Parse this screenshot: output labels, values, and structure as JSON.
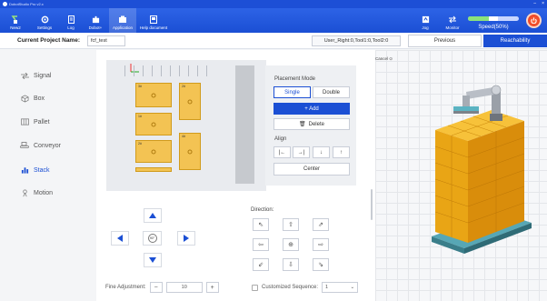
{
  "titlebar": {
    "app_name": "DobotStudio Pro v2.x",
    "min": "–",
    "close": "×"
  },
  "toolbar": {
    "items": [
      {
        "label": "New2",
        "icon": "robot-icon"
      },
      {
        "label": "Settings",
        "icon": "gear-icon"
      },
      {
        "label": "Log",
        "icon": "log-icon"
      },
      {
        "label": "Dobot+",
        "icon": "puzzle-icon"
      },
      {
        "label": "Application",
        "icon": "app-icon"
      },
      {
        "label": "Help document",
        "icon": "doc-icon"
      }
    ],
    "jog_label": "Jog",
    "monitor_label": "Monitor",
    "speed_label": "Speed(50%)",
    "speed_value": 50
  },
  "project": {
    "label": "Current Project Name:",
    "name": "fcf_test",
    "tool_info": "User_Right:0,Tool1:0,Tool2:0",
    "previous_label": "Previous",
    "reachability_label": "Reachability"
  },
  "sidebar": {
    "items": [
      {
        "label": "Signal",
        "icon": "signal-icon"
      },
      {
        "label": "Box",
        "icon": "box-icon"
      },
      {
        "label": "Pallet",
        "icon": "pallet-icon"
      },
      {
        "label": "Conveyor",
        "icon": "conveyor-icon"
      },
      {
        "label": "Stack",
        "icon": "stack-icon"
      },
      {
        "label": "Motion",
        "icon": "motion-icon"
      }
    ],
    "active_index": 4
  },
  "canvas": {
    "boxes": [
      {
        "label": "3#"
      },
      {
        "label": "2#"
      },
      {
        "label": "1#"
      },
      {
        "label": "4#"
      },
      {
        "label": "2#"
      },
      {
        "label": "5#"
      }
    ]
  },
  "placement": {
    "title": "Placement Mode",
    "single": "Single",
    "double": "Double",
    "add": "+ Add",
    "delete": "Delete",
    "align_title": "Align",
    "center": "Center"
  },
  "direction": {
    "title": "Direction:",
    "rotate_label": "90°"
  },
  "fine": {
    "label": "Fine Adjustment:",
    "minus": "−",
    "plus": "+",
    "value": "10"
  },
  "sequence": {
    "label": "Customized Sequence:",
    "value": "1"
  },
  "view3d": {
    "cancel_label": "Cancel ⊙"
  }
}
